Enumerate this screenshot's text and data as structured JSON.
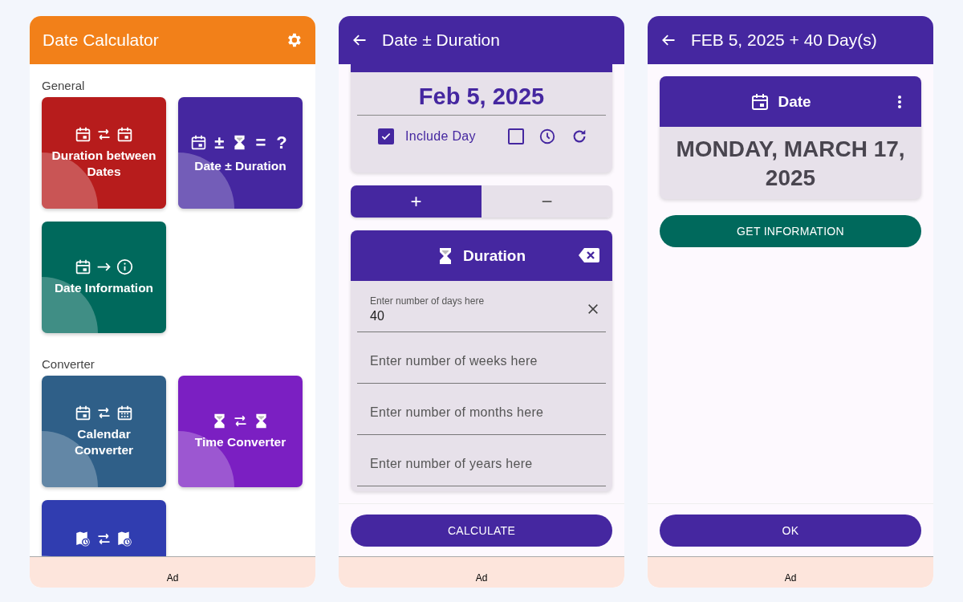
{
  "home": {
    "title": "Date Calculator",
    "sections": [
      {
        "label": "General",
        "tiles": [
          {
            "label": "Duration between Dates",
            "color": "#b71c1c"
          },
          {
            "label": "Date ± Duration",
            "color": "#4527a0",
            "symbols": [
              "±",
              "=",
              "?"
            ]
          },
          {
            "label": "Date Information",
            "color": "#00695c"
          }
        ]
      },
      {
        "label": "Converter",
        "tiles": [
          {
            "label": "Calendar Converter",
            "color": "#2f5f88"
          },
          {
            "label": "Time Converter",
            "color": "#7b1fc2"
          },
          {
            "color": "#303db0"
          }
        ]
      }
    ],
    "ad": "Ad"
  },
  "date_duration": {
    "title": "Date ± Duration",
    "start_date": "Feb 5, 2025",
    "include_day": {
      "label": "Include Day",
      "checked": true
    },
    "option_checkbox": {
      "checked": false
    },
    "operations": [
      {
        "label": "+",
        "selected": true
      },
      {
        "label": "−",
        "selected": false
      }
    ],
    "duration_card": {
      "title": "Duration",
      "fields": [
        {
          "label": "Enter number of days here",
          "value": "40"
        },
        {
          "placeholder": "Enter number of weeks here"
        },
        {
          "placeholder": "Enter number of months here"
        },
        {
          "placeholder": "Enter number of years here"
        }
      ]
    },
    "calculate_button": "CALCULATE",
    "ad": "Ad"
  },
  "result": {
    "title": "FEB 5, 2025 + 40 Day(s)",
    "card": {
      "title": "Date",
      "value": "MONDAY, MARCH 17, 2025"
    },
    "info_button": "GET INFORMATION",
    "ok_button": "OK",
    "ad": "Ad"
  }
}
